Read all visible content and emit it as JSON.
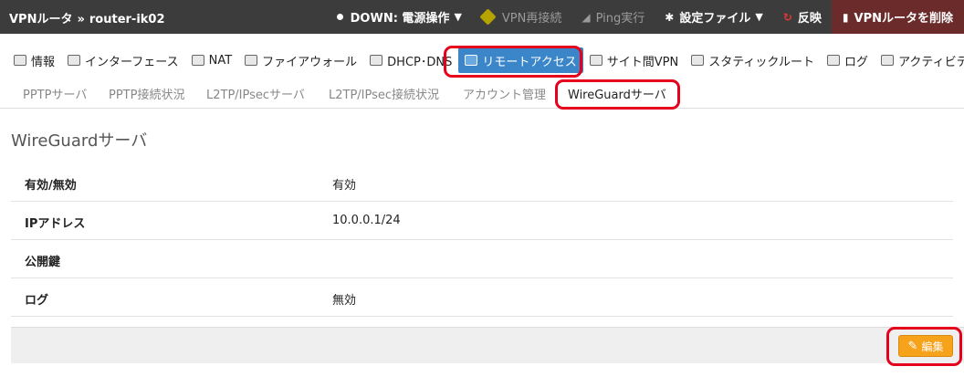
{
  "breadcrumb": {
    "root": "VPNルータ",
    "separator": "»",
    "current": "router-ik02"
  },
  "topnav": {
    "status": "DOWN: 電源操作",
    "vpn_restart": "VPN再接続",
    "ping": "Ping実行",
    "settings_file": "設定ファイル",
    "apply": "反映",
    "delete_router": "VPNルータを削除"
  },
  "main_tabs": [
    {
      "label": "情報",
      "icon": "info-icon"
    },
    {
      "label": "インターフェース",
      "icon": "interface-icon"
    },
    {
      "label": "NAT",
      "icon": "nat-icon"
    },
    {
      "label": "ファイアウォール",
      "icon": "firewall-icon"
    },
    {
      "label": "DHCP･DNS",
      "icon": "dhcp-icon"
    },
    {
      "label": "リモートアクセス",
      "icon": "remote-access-icon",
      "active": true
    },
    {
      "label": "サイト間VPN",
      "icon": "site-vpn-icon"
    },
    {
      "label": "スタティックルート",
      "icon": "static-route-icon"
    },
    {
      "label": "ログ",
      "icon": "log-icon"
    },
    {
      "label": "アクティビティ",
      "icon": "activity-icon"
    }
  ],
  "sub_tabs": [
    {
      "label": "PPTPサーバ"
    },
    {
      "label": "PPTP接続状況"
    },
    {
      "label": "L2TP/IPsecサーバ"
    },
    {
      "label": "L2TP/IPsec接続状況"
    },
    {
      "label": "アカウント管理"
    },
    {
      "label": "WireGuardサーバ",
      "active": true
    }
  ],
  "page_title": "WireGuardサーバ",
  "details": [
    {
      "key": "有効/無効",
      "value": "有効"
    },
    {
      "key": "IPアドレス",
      "value": "10.0.0.1/24"
    },
    {
      "key": "公開鍵",
      "value": ""
    },
    {
      "key": "ログ",
      "value": "無効"
    }
  ],
  "edit_label": "編集",
  "colors": {
    "accent": "#3a86c8",
    "highlight": "#e5001c",
    "edit_button": "#f6a21b",
    "topbar": "#3c3c3c"
  }
}
